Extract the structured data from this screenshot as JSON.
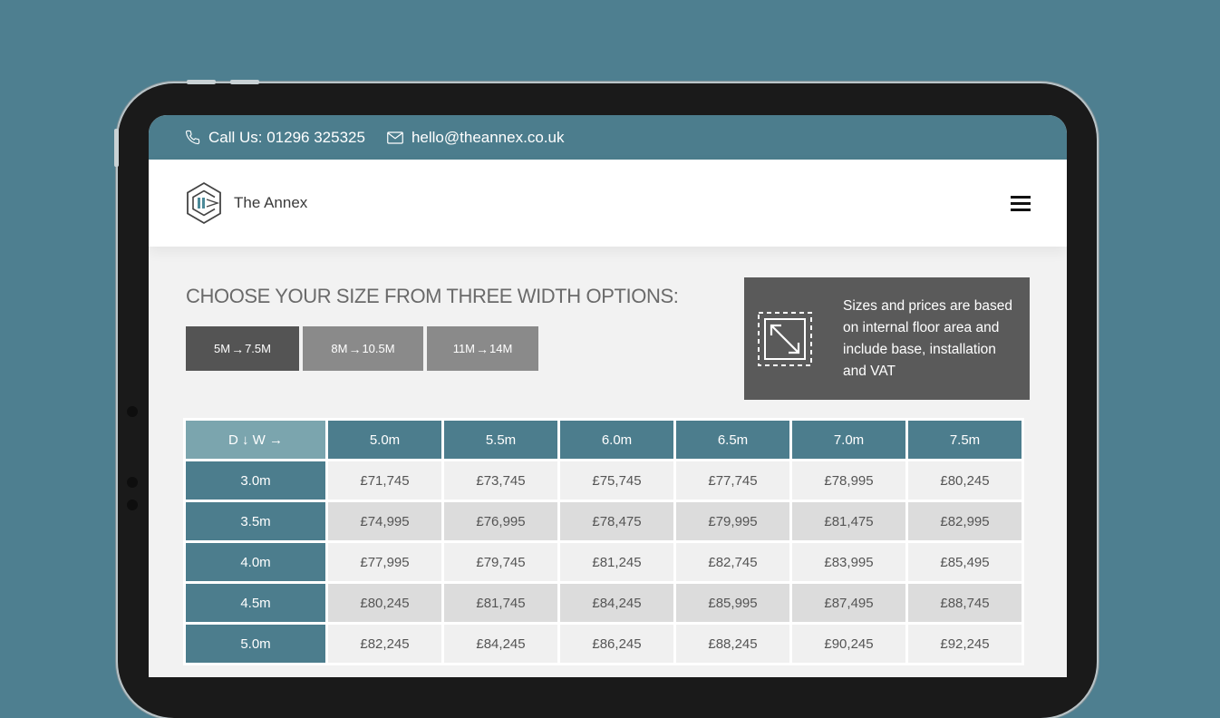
{
  "topbar": {
    "phone_label": "Call Us: 01296 325325",
    "email_label": "hello@theannex.co.uk"
  },
  "navbar": {
    "brand_name": "The Annex"
  },
  "size_section": {
    "title": "CHOOSE YOUR SIZE FROM THREE WIDTH OPTIONS:",
    "tabs": [
      {
        "from": "5M",
        "to": "7.5M",
        "active": true
      },
      {
        "from": "8M",
        "to": "10.5M",
        "active": false
      },
      {
        "from": "11M",
        "to": "14M",
        "active": false
      }
    ]
  },
  "info_box": {
    "text": "Sizes and prices are based on internal floor area and include base, installation and VAT"
  },
  "price_table": {
    "corner_d": "D",
    "corner_w": "W",
    "columns": [
      "5.0m",
      "5.5m",
      "6.0m",
      "6.5m",
      "7.0m",
      "7.5m"
    ],
    "rows": [
      {
        "depth": "3.0m",
        "prices": [
          "£71,745",
          "£73,745",
          "£75,745",
          "£77,745",
          "£78,995",
          "£80,245"
        ]
      },
      {
        "depth": "3.5m",
        "prices": [
          "£74,995",
          "£76,995",
          "£78,475",
          "£79,995",
          "£81,475",
          "£82,995"
        ]
      },
      {
        "depth": "4.0m",
        "prices": [
          "£77,995",
          "£79,745",
          "£81,245",
          "£82,745",
          "£83,995",
          "£85,495"
        ]
      },
      {
        "depth": "4.5m",
        "prices": [
          "£80,245",
          "£81,745",
          "£84,245",
          "£85,995",
          "£87,495",
          "£88,745"
        ]
      },
      {
        "depth": "5.0m",
        "prices": [
          "£82,245",
          "£84,245",
          "£86,245",
          "£88,245",
          "£90,245",
          "£92,245"
        ]
      }
    ]
  },
  "colors": {
    "background": "#4e7f90",
    "brand_teal": "#4c7d8d",
    "corner_teal": "#7ba5ae",
    "active_tab": "#545454",
    "inactive_tab": "#8a8a8a",
    "info_box": "#5a5a5a"
  }
}
